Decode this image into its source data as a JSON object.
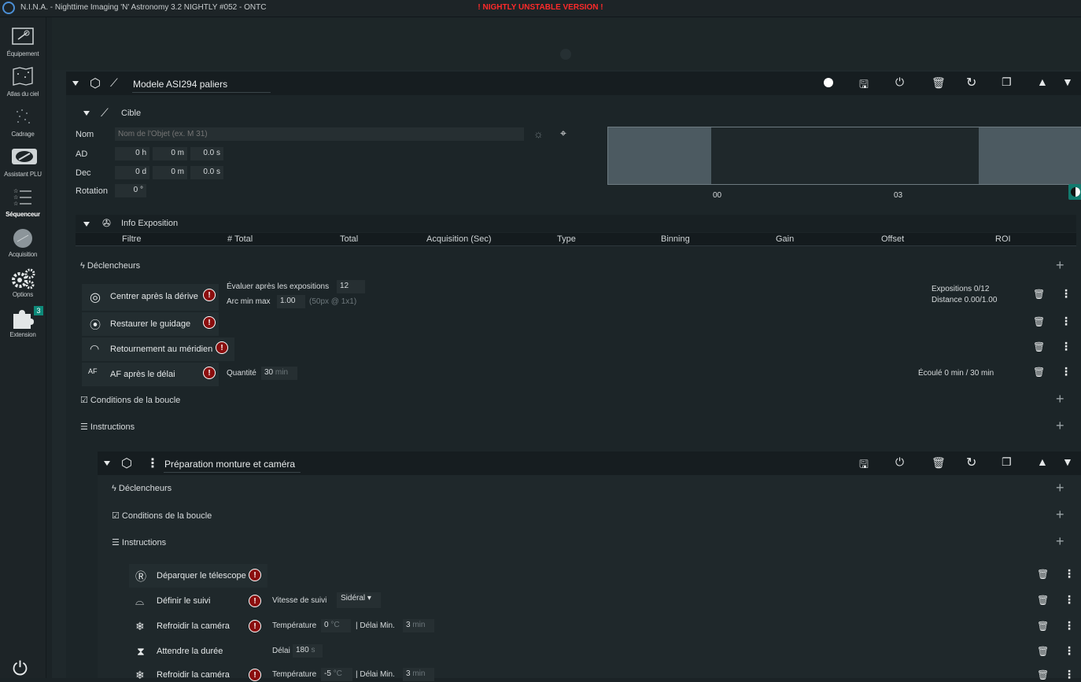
{
  "window": {
    "title": "N.I.N.A. - Nighttime Imaging 'N' Astronomy 3.2 NIGHTLY #052  -  ONTC",
    "warning": "! NIGHTLY UNSTABLE VERSION !"
  },
  "sidebar": {
    "items": [
      {
        "label": "Équipement",
        "icon": "camera-icon"
      },
      {
        "label": "Atlas du ciel",
        "icon": "sky-atlas-icon"
      },
      {
        "label": "Cadrage",
        "icon": "framing-icon"
      },
      {
        "label": "Assistant PLU",
        "icon": "flat-wizard-icon"
      },
      {
        "label": "Séquenceur",
        "icon": "sequencer-icon"
      },
      {
        "label": "Acquisition",
        "icon": "imaging-icon"
      },
      {
        "label": "Options",
        "icon": "gears-icon"
      },
      {
        "label": "Extension",
        "icon": "puzzle-icon"
      }
    ],
    "extension_badge": "3",
    "active": "Séquenceur"
  },
  "target_container": {
    "title": "Modele ASI294 paliers",
    "target_section": {
      "label": "Cible",
      "name_label": "Nom",
      "name_placeholder": "Nom de l'Objet (ex. M 31)",
      "ra_label": "AD",
      "ra_h": "0",
      "ra_h_unit": "h",
      "ra_m": "0",
      "ra_m_unit": "m",
      "ra_s": "0.0",
      "ra_s_unit": "s",
      "dec_label": "Dec",
      "dec_d": "0",
      "dec_d_unit": "d",
      "dec_m": "0",
      "dec_m_unit": "m",
      "dec_s": "0.0",
      "dec_s_unit": "s",
      "rotation_label": "Rotation",
      "rotation_value": "0",
      "rotation_unit": "°",
      "altitude_ticks": [
        "00",
        "03"
      ]
    },
    "exposure_info": {
      "label": "Info Exposition",
      "columns": [
        "Filtre",
        "# Total",
        "Total",
        "Acquisition (Sec)",
        "Type",
        "Binning",
        "Gain",
        "Offset",
        "ROI"
      ]
    },
    "triggers_label": "Déclencheurs",
    "triggers": [
      {
        "name": "Centrer après la dérive",
        "icon": "target-icon",
        "param1_label": "Évaluer après les expositions",
        "param1_value": "12",
        "param2_label": "Arc min max",
        "param2_value": "1.00",
        "param2_hint": "(50px @ 1x1)",
        "status1": "Expositions 0/12",
        "status2": "Distance 0.00/1.00"
      },
      {
        "name": "Restaurer le guidage",
        "icon": "guiding-icon"
      },
      {
        "name": "Retournement au méridien",
        "icon": "meridian-flip-icon"
      },
      {
        "name": "AF après le délai",
        "icon": "autofocus-icon",
        "param1_label": "Quantité",
        "param1_value": "30",
        "param1_unit": "min",
        "status1": "Écoulé 0 min / 30 min"
      }
    ],
    "loop_conditions_label": "Conditions de la boucle",
    "instructions_label": "Instructions"
  },
  "sub_container": {
    "title": "Préparation monture et caméra",
    "triggers_label": "Déclencheurs",
    "loop_conditions_label": "Conditions de la boucle",
    "instructions_label": "Instructions",
    "instructions": [
      {
        "name": "Déparquer le télescope",
        "icon": "unpark-icon"
      },
      {
        "name": "Définir le suivi",
        "icon": "tracking-icon",
        "param_label": "Vitesse de suivi",
        "param_value": "Sidéral"
      },
      {
        "name": "Refroidir la caméra",
        "icon": "snowflake-icon",
        "temp_label": "Température",
        "temp_value": "0",
        "temp_unit": "°C",
        "delay_label": "| Délai Min.",
        "delay_value": "3",
        "delay_unit": "min"
      },
      {
        "name": "Attendre la durée",
        "icon": "hourglass-icon",
        "delay_label": "Délai",
        "delay_value": "180",
        "delay_unit": "s"
      },
      {
        "name": "Refroidir la caméra",
        "icon": "snowflake-icon",
        "temp_label": "Température",
        "temp_value": "-5",
        "temp_unit": "°C",
        "delay_label": "| Délai Min.",
        "delay_value": "3",
        "delay_unit": "min"
      }
    ]
  },
  "colors": {
    "accent_teal": "#127a6e",
    "error_red": "#8a0e0e",
    "warning_red": "#ff2a2a"
  }
}
